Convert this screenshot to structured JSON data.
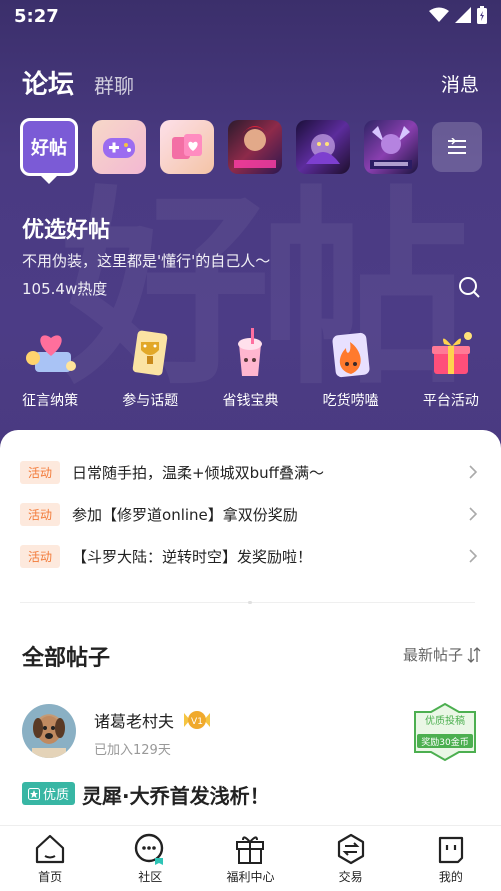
{
  "status_bar": {
    "time": "5:27",
    "icons": [
      "wifi-icon",
      "signal-icon",
      "battery-icon"
    ]
  },
  "header": {
    "tab_active": "论坛",
    "tab_inactive": "群聊",
    "message": "消息"
  },
  "forums": {
    "selected_label": "好帖",
    "icons": [
      "game-controller-icon",
      "heart-card-icon",
      "game-cover-kof",
      "game-cover-shura",
      "game-cover-moshi"
    ],
    "menu_icon": "list-menu-icon"
  },
  "section": {
    "title": "优选好帖",
    "subtitle": "不用伪装，这里都是'懂行'的自己人～",
    "heat": "105.4w热度",
    "search_icon": "search-icon",
    "watermark": "好帖"
  },
  "categories": [
    {
      "label": "征言纳策",
      "icon": "heart-envelope-icon"
    },
    {
      "label": "参与话题",
      "icon": "trophy-card-icon"
    },
    {
      "label": "省钱宝典",
      "icon": "drink-cup-icon"
    },
    {
      "label": "吃货唠嗑",
      "icon": "flame-food-icon"
    },
    {
      "label": "平台活动",
      "icon": "gift-box-icon"
    }
  ],
  "announcements": [
    {
      "badge": "活动",
      "text": "日常随手拍，温柔+倾城双buff叠满～"
    },
    {
      "badge": "活动",
      "text": "参加【修罗道online】拿双份奖励"
    },
    {
      "badge": "活动",
      "text": "【斗罗大陆：逆转时空】发奖励啦！"
    }
  ],
  "posts_header": {
    "title": "全部帖子",
    "sort": "最新帖子",
    "sort_icon": "sort-arrows-icon"
  },
  "post": {
    "author": "诸葛老村夫",
    "level": "V1",
    "joined": "已加入129天",
    "stamp_top": "优质投稿",
    "stamp_bottom": "奖励30金币",
    "quality_badge": "优质",
    "title": "灵犀·大乔首发浅析！"
  },
  "bottom_nav": [
    {
      "label": "首页",
      "icon": "home-icon"
    },
    {
      "label": "社区",
      "icon": "community-chat-icon"
    },
    {
      "label": "福利中心",
      "icon": "gift-icon"
    },
    {
      "label": "交易",
      "icon": "exchange-icon"
    },
    {
      "label": "我的",
      "icon": "profile-icon"
    }
  ],
  "colors": {
    "hero_bg": "#4a3a82",
    "badge_orange": "#f27b3a",
    "quality_green": "#38b6a4",
    "stamp_green": "#4caf50"
  }
}
